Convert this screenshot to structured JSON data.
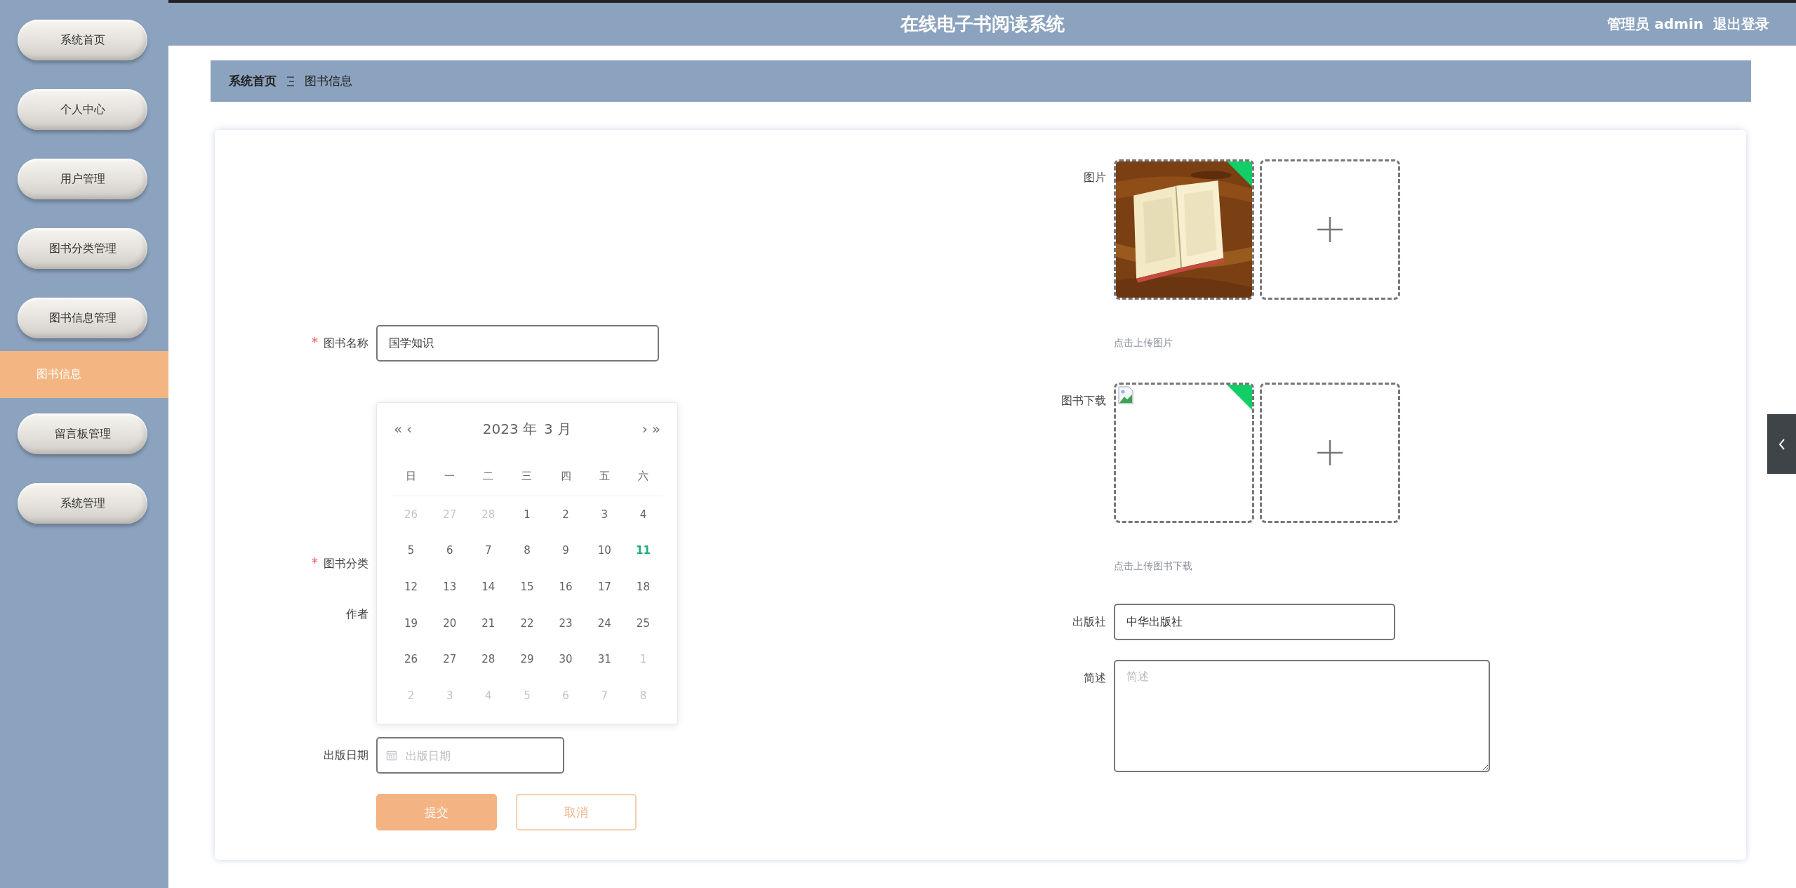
{
  "sidebar": {
    "items": [
      {
        "label": "系统首页",
        "selected": false
      },
      {
        "label": "个人中心",
        "selected": false
      },
      {
        "label": "用户管理",
        "selected": false
      },
      {
        "label": "图书分类管理",
        "selected": false
      },
      {
        "label": "图书信息管理",
        "selected": false
      },
      {
        "label": "图书信息",
        "selected": true
      },
      {
        "label": "留言板管理",
        "selected": false
      },
      {
        "label": "系统管理",
        "selected": false
      }
    ]
  },
  "header": {
    "title": "在线电子书阅读系统",
    "user": "管理员 admin",
    "logout": "退出登录"
  },
  "breadcrumb": {
    "items": [
      "系统首页",
      "图书信息"
    ]
  },
  "form": {
    "left_fields": [
      {
        "kind": "text",
        "label": "图书名称",
        "required": true,
        "value": "国学知识"
      },
      {
        "kind": "covered",
        "label": "图书分类",
        "required": true
      },
      {
        "kind": "covered",
        "label": "作者",
        "required": false
      },
      {
        "kind": "date",
        "label": "出版日期",
        "required": false,
        "placeholder": "出版日期"
      }
    ],
    "date_picker": {
      "nav": {
        "prev_year": "«",
        "prev_month": "‹",
        "next_month": "›",
        "next_year": "»"
      },
      "year_label": "2023 年",
      "month_label": "3 月",
      "weekdays": [
        "日",
        "一",
        "二",
        "三",
        "四",
        "五",
        "六"
      ],
      "weeks": [
        [
          {
            "day": "26",
            "in_month": false,
            "today": false
          },
          {
            "day": "27",
            "in_month": false,
            "today": false
          },
          {
            "day": "28",
            "in_month": false,
            "today": false
          },
          {
            "day": "1",
            "in_month": true,
            "today": false
          },
          {
            "day": "2",
            "in_month": true,
            "today": false
          },
          {
            "day": "3",
            "in_month": true,
            "today": false
          },
          {
            "day": "4",
            "in_month": true,
            "today": false
          }
        ],
        [
          {
            "day": "5",
            "in_month": true,
            "today": false
          },
          {
            "day": "6",
            "in_month": true,
            "today": false
          },
          {
            "day": "7",
            "in_month": true,
            "today": false
          },
          {
            "day": "8",
            "in_month": true,
            "today": false
          },
          {
            "day": "9",
            "in_month": true,
            "today": false
          },
          {
            "day": "10",
            "in_month": true,
            "today": false
          },
          {
            "day": "11",
            "in_month": true,
            "today": true
          }
        ],
        [
          {
            "day": "12",
            "in_month": true,
            "today": false
          },
          {
            "day": "13",
            "in_month": true,
            "today": false
          },
          {
            "day": "14",
            "in_month": true,
            "today": false
          },
          {
            "day": "15",
            "in_month": true,
            "today": false
          },
          {
            "day": "16",
            "in_month": true,
            "today": false
          },
          {
            "day": "17",
            "in_month": true,
            "today": false
          },
          {
            "day": "18",
            "in_month": true,
            "today": false
          }
        ],
        [
          {
            "day": "19",
            "in_month": true,
            "today": false
          },
          {
            "day": "20",
            "in_month": true,
            "today": false
          },
          {
            "day": "21",
            "in_month": true,
            "today": false
          },
          {
            "day": "22",
            "in_month": true,
            "today": false
          },
          {
            "day": "23",
            "in_month": true,
            "today": false
          },
          {
            "day": "24",
            "in_month": true,
            "today": false
          },
          {
            "day": "25",
            "in_month": true,
            "today": false
          }
        ],
        [
          {
            "day": "26",
            "in_month": true,
            "today": false
          },
          {
            "day": "27",
            "in_month": true,
            "today": false
          },
          {
            "day": "28",
            "in_month": true,
            "today": false
          },
          {
            "day": "29",
            "in_month": true,
            "today": false
          },
          {
            "day": "30",
            "in_month": true,
            "today": false
          },
          {
            "day": "31",
            "in_month": true,
            "today": false
          },
          {
            "day": "1",
            "in_month": false,
            "today": false
          }
        ],
        [
          {
            "day": "2",
            "in_month": false,
            "today": false
          },
          {
            "day": "3",
            "in_month": false,
            "today": false
          },
          {
            "day": "4",
            "in_month": false,
            "today": false
          },
          {
            "day": "5",
            "in_month": false,
            "today": false
          },
          {
            "day": "6",
            "in_month": false,
            "today": false
          },
          {
            "day": "7",
            "in_month": false,
            "today": false
          },
          {
            "day": "8",
            "in_month": false,
            "today": false
          }
        ]
      ]
    },
    "buttons": [
      {
        "kind": "primary",
        "label": "提交"
      },
      {
        "kind": "plain",
        "label": "取消"
      }
    ],
    "uploads": [
      {
        "label": "图片",
        "files": [
          {
            "kind": "picture",
            "uploaded": true
          }
        ],
        "hint": "点击上传图片"
      },
      {
        "label": "图书下载",
        "files": [
          {
            "kind": "broken",
            "uploaded": true
          }
        ],
        "hint": "点击上传图书下载"
      }
    ],
    "right_fields": [
      {
        "kind": "text",
        "label": "出版社",
        "value": "中华出版社"
      },
      {
        "kind": "textarea",
        "label": "简述",
        "placeholder": "简述"
      }
    ]
  }
}
